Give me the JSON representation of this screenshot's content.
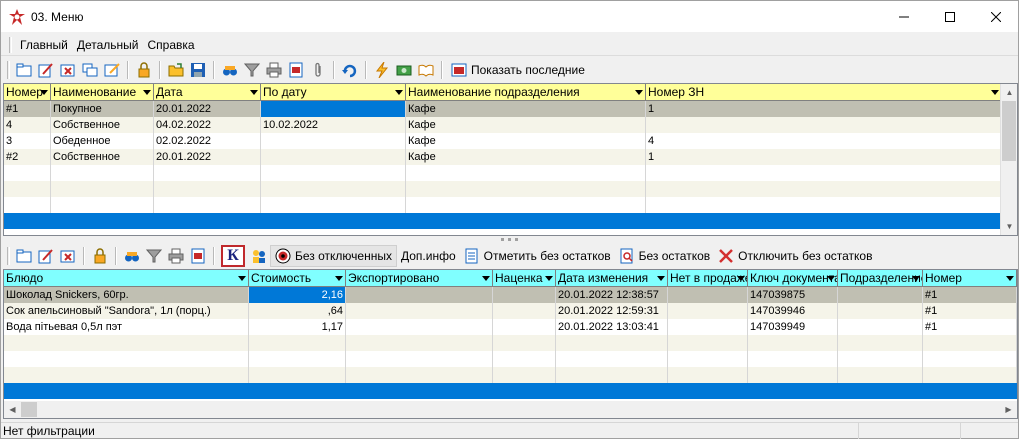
{
  "window": {
    "title": "03. Меню"
  },
  "menu": [
    "Главный",
    "Детальный",
    "Справка"
  ],
  "top_toolbar": {
    "show_last_label": "Показать последние"
  },
  "top_grid": {
    "columns": [
      "Номер",
      "Наименование",
      "Дата",
      "По дату",
      "Наименование подразделения",
      "Номер ЗН"
    ],
    "rows": [
      [
        "#1",
        "Покупное",
        "20.01.2022",
        "",
        "Кафе",
        "1"
      ],
      [
        "4",
        "Собственное",
        "04.02.2022",
        "10.02.2022",
        "Кафе",
        ""
      ],
      [
        "3",
        "Обеденное",
        "02.02.2022",
        "",
        "Кафе",
        "4"
      ],
      [
        "#2",
        "Собственное",
        "20.01.2022",
        "",
        "Кафе",
        "1"
      ]
    ]
  },
  "bottom_toolbar": {
    "k_label": "К",
    "no_disabled_label": "Без отключенных",
    "extra_info_label": "Доп.инфо",
    "mark_no_stock_label": "Отметить без остатков",
    "no_stock_label": "Без остатков",
    "disable_no_stock_label": "Отключить без остатков"
  },
  "bottom_grid": {
    "columns": [
      "Блюдо",
      "Стоимость",
      "Экспортировано",
      "Наценка",
      "Дата изменения",
      "Нет в продаже",
      "Ключ документа",
      "Подразделение",
      "Номер"
    ],
    "rows": [
      [
        "Шоколад Snickers, 60гр.",
        "2,16",
        "",
        "",
        "20.01.2022 12:38:57",
        "",
        "147039875",
        "",
        "#1"
      ],
      [
        "Сок апельсиновый \"Sandora\", 1л (порц.)",
        ",64",
        "",
        "",
        "20.01.2022 12:59:31",
        "",
        "147039946",
        "",
        "#1"
      ],
      [
        "Вода пітьевая 0,5л пэт",
        "1,17",
        "",
        "",
        "20.01.2022 13:03:41",
        "",
        "147039949",
        "",
        "#1"
      ]
    ]
  },
  "status": {
    "filter_text": "Нет фильтрации"
  },
  "colors": {
    "top_header": "#ffff99",
    "bottom_header": "#80ffff",
    "selected_row": "#c0bfb2",
    "alt_row": "#f5f4e9",
    "accent_blue": "#0078d7"
  }
}
